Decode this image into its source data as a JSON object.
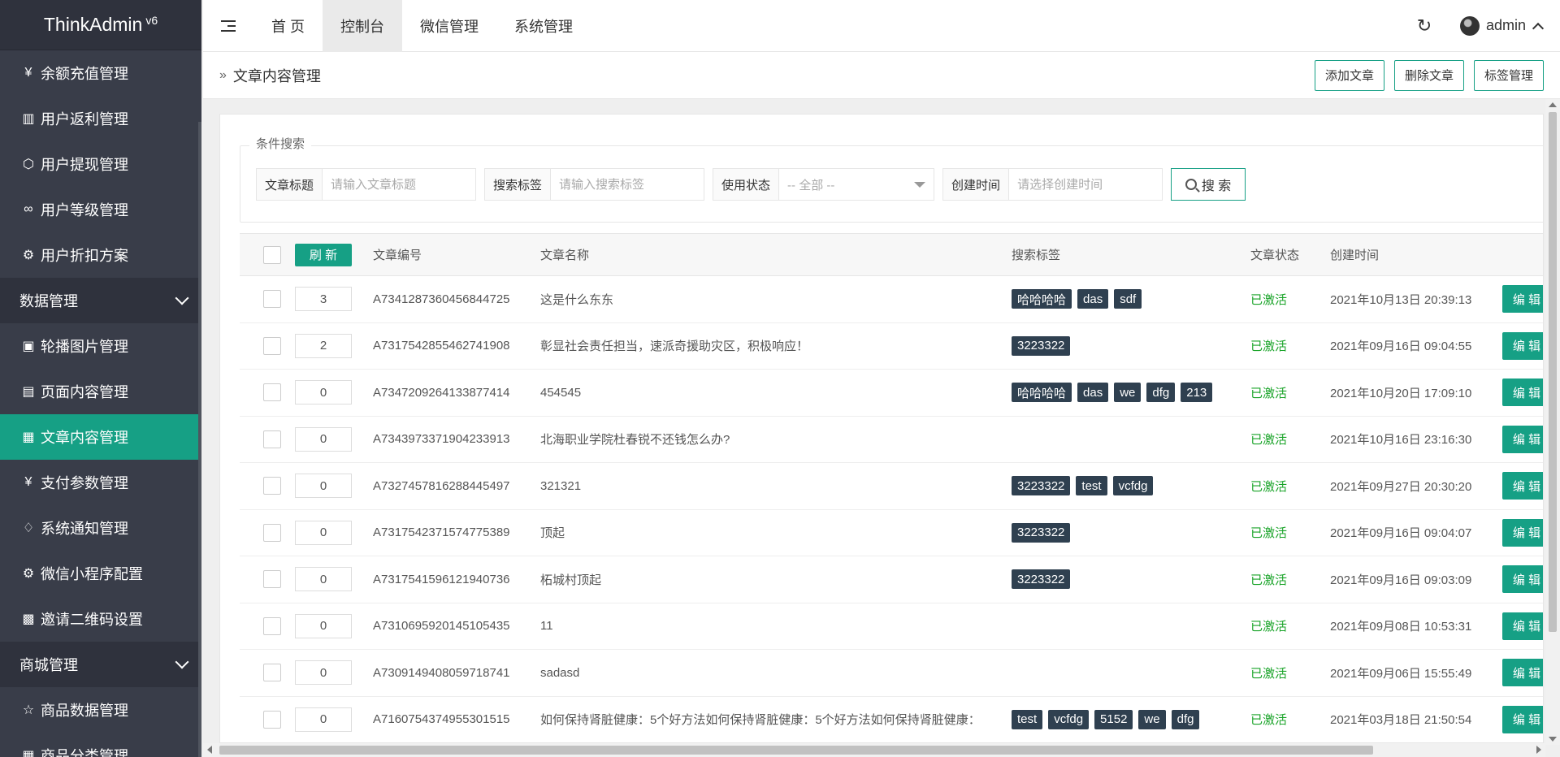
{
  "app": {
    "name": "ThinkAdmin",
    "version": "v6"
  },
  "sidebar": {
    "items": [
      {
        "label": "余额充值管理",
        "icon": "yen-icon",
        "glyph": "¥"
      },
      {
        "label": "用户返利管理",
        "icon": "columns-icon",
        "glyph": "▥"
      },
      {
        "label": "用户提现管理",
        "icon": "cube-icon",
        "glyph": "⬡"
      },
      {
        "label": "用户等级管理",
        "icon": "infinity-icon",
        "glyph": "∞"
      },
      {
        "label": "用户折扣方案",
        "icon": "gear-icon",
        "glyph": "⚙"
      }
    ],
    "group_data": {
      "label": "数据管理"
    },
    "data_items": [
      {
        "label": "轮播图片管理",
        "icon": "image-icon",
        "glyph": "▣"
      },
      {
        "label": "页面内容管理",
        "icon": "book-icon",
        "glyph": "▤"
      },
      {
        "label": "文章内容管理",
        "icon": "article-icon",
        "glyph": "▦"
      },
      {
        "label": "支付参数管理",
        "icon": "yen-icon",
        "glyph": "¥"
      },
      {
        "label": "系统通知管理",
        "icon": "bell-icon",
        "glyph": "♢"
      },
      {
        "label": "微信小程序配置",
        "icon": "gear-icon",
        "glyph": "⚙"
      },
      {
        "label": "邀请二维码设置",
        "icon": "qrcode-icon",
        "glyph": "▩"
      }
    ],
    "group_shop": {
      "label": "商城管理"
    },
    "shop_items": [
      {
        "label": "商品数据管理",
        "icon": "star-icon",
        "glyph": "☆"
      },
      {
        "label": "商品分类管理",
        "icon": "category-icon",
        "glyph": "▦"
      }
    ]
  },
  "topbar": {
    "tabs": [
      {
        "label": "首 页"
      },
      {
        "label": "控制台"
      },
      {
        "label": "微信管理"
      },
      {
        "label": "系统管理"
      }
    ],
    "refresh_glyph": "↻",
    "user": "admin"
  },
  "page": {
    "crumb_glyph": "»",
    "title": "文章内容管理",
    "buttons": {
      "add": "添加文章",
      "delete": "删除文章",
      "tags": "标签管理"
    }
  },
  "search": {
    "legend": "条件搜索",
    "title_label": "文章标题",
    "title_placeholder": "请输入文章标题",
    "tag_label": "搜索标签",
    "tag_placeholder": "请输入搜索标签",
    "status_label": "使用状态",
    "status_value": "-- 全部 --",
    "time_label": "创建时间",
    "time_placeholder": "请选择创建时间",
    "button": "搜 索"
  },
  "table": {
    "refresh_label": "刷 新",
    "headers": {
      "code": "文章编号",
      "name": "文章名称",
      "tags": "搜索标签",
      "status": "文章状态",
      "time": "创建时间"
    },
    "edit_label": "编 辑",
    "rows": [
      {
        "sort": "3",
        "code": "A7341287360456844725",
        "name": "这是什么东东",
        "tags": [
          "哈哈哈哈",
          "das",
          "sdf"
        ],
        "status": "已激活",
        "time": "2021年10月13日 20:39:13"
      },
      {
        "sort": "2",
        "code": "A7317542855462741908",
        "name": "彰显社会责任担当，速派奇援助灾区，积极响应！",
        "tags": [
          "3223322"
        ],
        "status": "已激活",
        "time": "2021年09月16日 09:04:55"
      },
      {
        "sort": "0",
        "code": "A7347209264133877414",
        "name": "454545",
        "tags": [
          "哈哈哈哈",
          "das",
          "we",
          "dfg",
          "213"
        ],
        "status": "已激活",
        "time": "2021年10月20日 17:09:10"
      },
      {
        "sort": "0",
        "code": "A7343973371904233913",
        "name": "北海职业学院杜春锐不还钱怎么办?",
        "tags": [],
        "status": "已激活",
        "time": "2021年10月16日 23:16:30"
      },
      {
        "sort": "0",
        "code": "A7327457816288445497",
        "name": "321321",
        "tags": [
          "3223322",
          "test",
          "vcfdg"
        ],
        "status": "已激活",
        "time": "2021年09月27日 20:30:20"
      },
      {
        "sort": "0",
        "code": "A7317542371574775389",
        "name": "顶起",
        "tags": [
          "3223322"
        ],
        "status": "已激活",
        "time": "2021年09月16日 09:04:07"
      },
      {
        "sort": "0",
        "code": "A7317541596121940736",
        "name": "柘城村顶起",
        "tags": [
          "3223322"
        ],
        "status": "已激活",
        "time": "2021年09月16日 09:03:09"
      },
      {
        "sort": "0",
        "code": "A7310695920145105435",
        "name": "11",
        "tags": [],
        "status": "已激活",
        "time": "2021年09月08日 10:53:31"
      },
      {
        "sort": "0",
        "code": "A7309149408059718741",
        "name": "sadasd",
        "tags": [],
        "status": "已激活",
        "time": "2021年09月06日 15:55:49"
      },
      {
        "sort": "0",
        "code": "A7160754374955301515",
        "name": "如何保持肾脏健康：5个好方法如何保持肾脏健康：5个好方法如何保持肾脏健康：",
        "tags": [
          "test",
          "vcfdg",
          "5152",
          "we",
          "dfg"
        ],
        "status": "已激活",
        "time": "2021年03月18日 21:50:54"
      }
    ]
  },
  "colors": {
    "accent": "#16a085",
    "sidebar_bg": "#393d49",
    "tag_bg": "#2f4050",
    "status_green": "#18a327"
  }
}
